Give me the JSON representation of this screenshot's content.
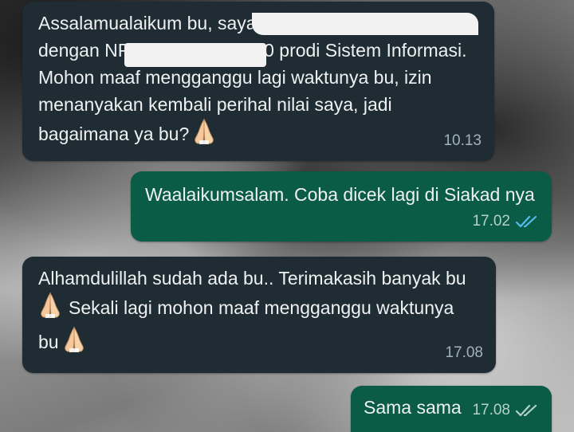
{
  "messages": [
    {
      "direction": "incoming",
      "lines": [
        "Assalamualaikum bu, saya",
        "dengan NP",
        "0 prodi Sistem Informasi.",
        "Mohon maaf mengganggu lagi waktunya bu, izin",
        "menanyakan kembali perihal nilai saya, jadi",
        "bagaimana ya bu?"
      ],
      "emoji": "folded-hands",
      "time": "10.13"
    },
    {
      "direction": "outgoing",
      "text": "Waalaikumsalam. Coba dicek lagi di Siakad nya",
      "time": "17.02",
      "status": "read"
    },
    {
      "direction": "incoming",
      "lines": [
        "Alhamdulillah sudah ada bu.. Terimakasih banyak bu",
        "Sekali lagi mohon maaf mengganggu waktunya",
        "bu"
      ],
      "emoji": "folded-hands",
      "time": "17.08"
    },
    {
      "direction": "outgoing",
      "text": "Sama sama",
      "time": "17.08",
      "status": "read"
    }
  ],
  "colors": {
    "incoming_bubble": "#1f2c33",
    "outgoing_bubble": "#0b5c47",
    "read_ticks": "#53bdeb",
    "sent_ticks": "#b5d1c8"
  }
}
